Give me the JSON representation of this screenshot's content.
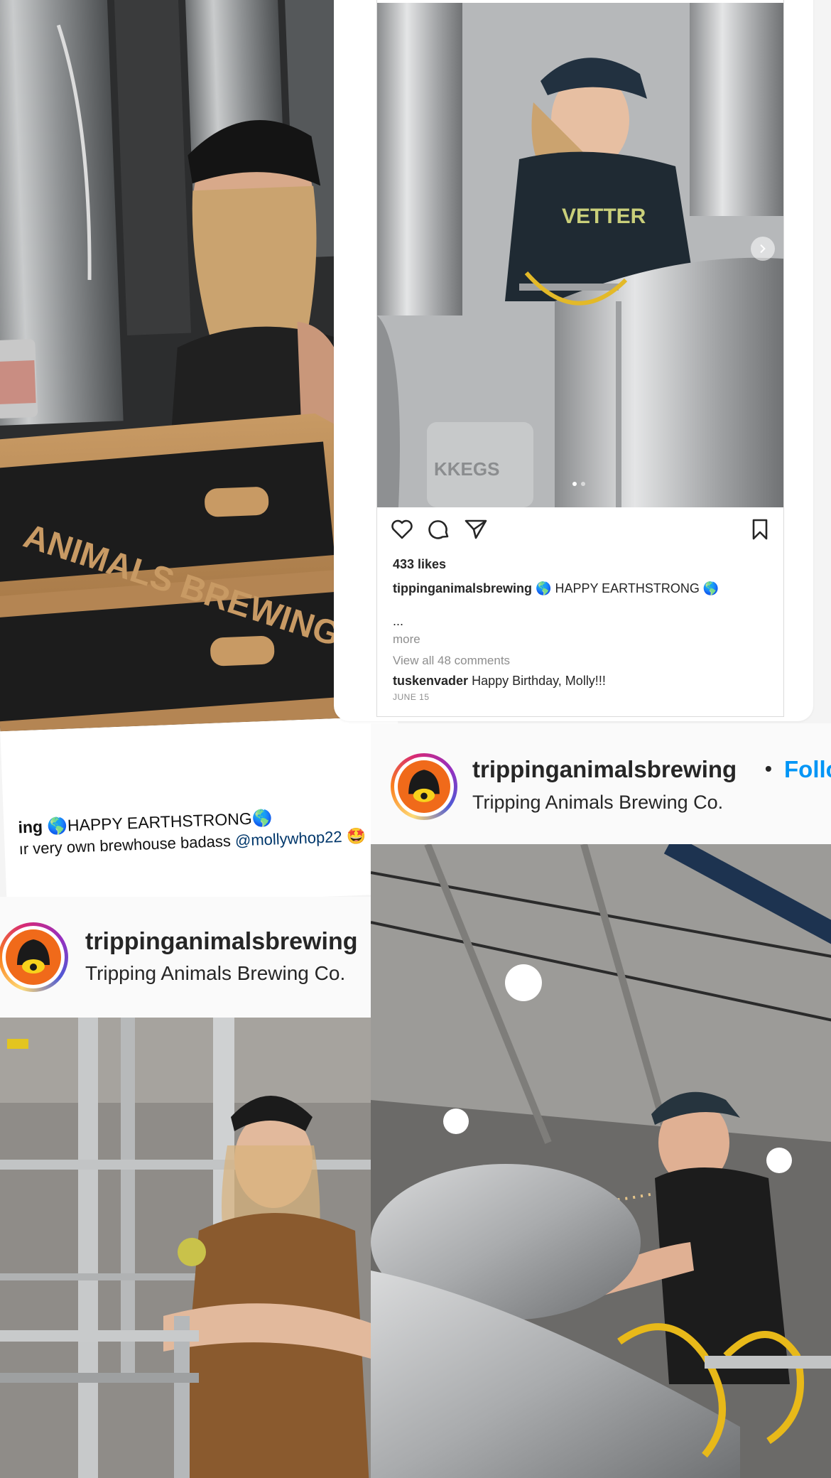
{
  "left_post": {
    "caption_user_fragment": "ing",
    "caption_text": "🌎HAPPY EARTHSTRONG🌎",
    "caption_line2_prefix": "ır very own brewhouse badass",
    "caption_mention": "@mollywhop22",
    "caption_emoji": "🤩"
  },
  "right_post": {
    "likes": "433 likes",
    "caption_user": "tippinganimalsbrewing",
    "caption_text": "🌎 HAPPY EARTHSTRONG 🌎",
    "ellipsis": "...",
    "more_label": "more",
    "view_all": "View all 48 comments",
    "comment_user": "tuskenvader",
    "comment_text": "Happy Birthday, Molly!!!",
    "date": "JUNE 15",
    "actions": {
      "like": "heart-icon",
      "comment": "comment-icon",
      "share": "send-icon",
      "save": "bookmark-icon"
    },
    "carousel_dots": 2,
    "carousel_active": 1
  },
  "header_right": {
    "username": "trippinganimalsbrewing",
    "separator": "•",
    "follow_label": "Follow",
    "fullname": "Tripping Animals Brewing Co."
  },
  "header_left": {
    "username": "trippinganimalsbrewing",
    "fullname": "Tripping Animals Brewing Co."
  },
  "colors": {
    "follow_blue": "#0095f6",
    "mention_blue": "#00376b",
    "avatar_orange": "#f06a1a"
  }
}
